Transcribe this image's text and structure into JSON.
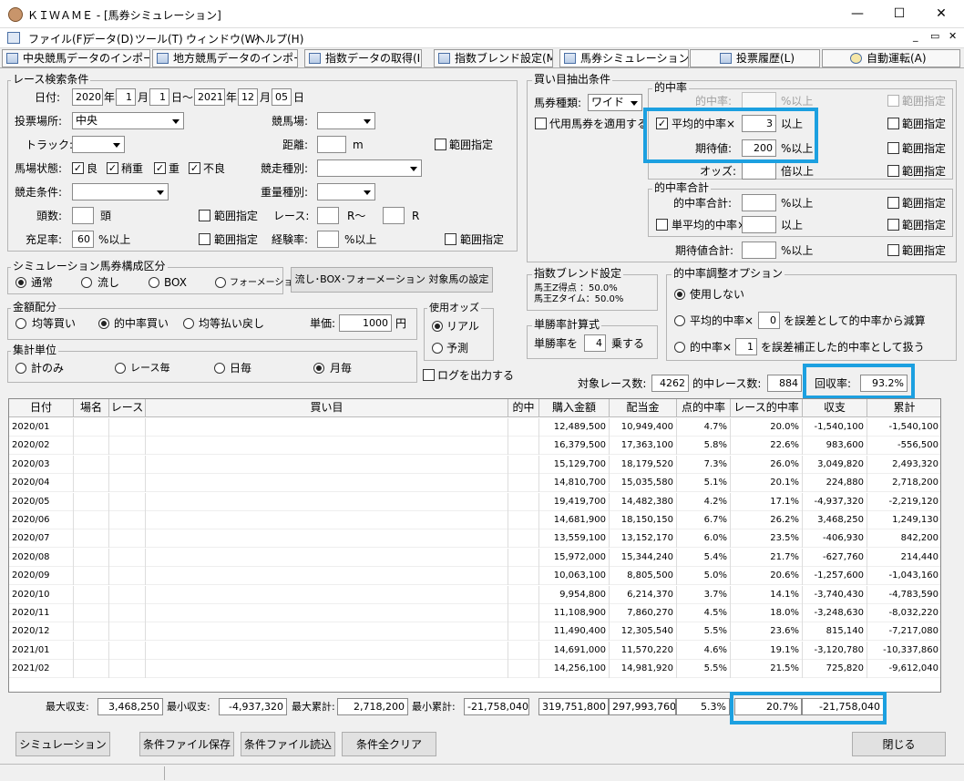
{
  "window": {
    "title": "ＫＩＷＡＭＥ - [馬券シミュレーション]"
  },
  "menu": [
    "ファイル(F)",
    "データ(D)",
    "ツール(T)",
    "ウィンドウ(W)",
    "ヘルプ(H)"
  ],
  "tabs": [
    "中央競馬データのインポート(J)",
    "地方競馬データのインポート(N)",
    "指数データの取得(I)",
    "指数ブレンド設定(M)",
    "馬券シミュレーション(B)",
    "投票履歴(L)",
    "自動運転(A)"
  ],
  "search": {
    "title": "レース検索条件",
    "date_label": "日付:",
    "from_year": "2020",
    "from_month": "1",
    "from_day": "1",
    "to_year": "2021",
    "to_month": "12",
    "to_day": "05",
    "year": "年",
    "month": "月",
    "day": "日",
    "tilde": "日～",
    "place_label": "投票場所:",
    "place": "中央",
    "course_label": "競馬場:",
    "track_label": "トラック:",
    "distance_label": "距離:",
    "m": "m",
    "range": "範囲指定",
    "condition_label": "馬場状態:",
    "cond": [
      "良",
      "稍重",
      "重",
      "不良"
    ],
    "race_type_label": "競走種別:",
    "race_cond_label": "競走条件:",
    "weight_label": "重量種別:",
    "heads_label": "頭数:",
    "heads_unit": "頭",
    "race_label": "レース:",
    "race_from": "R～",
    "race_to": "R",
    "fill_label": "充足率:",
    "fill": "60",
    "pct_over": "%以上",
    "exp_label": "経験率:"
  },
  "sim": {
    "title": "シミュレーション馬券構成区分",
    "opts": [
      "通常",
      "流し",
      "BOX",
      "フォーメーション"
    ],
    "setting_button": "流し･BOX･フォーメーション 対象馬の設定"
  },
  "money": {
    "title": "金額配分",
    "opts": [
      "均等買い",
      "的中率買い",
      "均等払い戻し"
    ],
    "unit_label": "単価:",
    "unit": "1000",
    "yen": "円"
  },
  "odds": {
    "title": "使用オッズ",
    "opts": [
      "リアル",
      "予測"
    ]
  },
  "agg": {
    "title": "集計単位",
    "opts": [
      "計のみ",
      "レース毎",
      "日毎",
      "月毎"
    ],
    "log": "ログを出力する"
  },
  "buy": {
    "title": "買い目抽出条件",
    "type_label": "馬券種類:",
    "type": "ワイド",
    "substitute": "代用馬券を適用する",
    "hit_title": "的中率",
    "hit": "的中率:",
    "avg_hit": "平均的中率×",
    "avg_val": "3",
    "ijo": "以上",
    "expect": "期待値:",
    "expect_val": "200",
    "odds": "オッズ:",
    "bai": "倍以上",
    "sum_title": "的中率合計",
    "sum_hit": "的中率合計:",
    "single": "単平均的中率×",
    "exp_sum": "期待値合計:",
    "range": "範囲指定",
    "pct_over": "%以上"
  },
  "blend": {
    "title": "指数ブレンド設定",
    "l1": "馬王Z得点 ：50.0%",
    "l2": "馬王Zタイム：50.0%"
  },
  "calc": {
    "title": "単勝率計算式",
    "pre": "単勝率を",
    "val": "4",
    "post": "乗する"
  },
  "adjust": {
    "title": "的中率調整オプション",
    "o1": "使用しない",
    "o2a": "平均的中率×",
    "o2v": "0",
    "o2b": "を誤差として的中率から減算",
    "o3a": "的中率×",
    "o3v": "1",
    "o3b": "を誤差補正した的中率として扱う"
  },
  "stats": {
    "target_label": "対象レース数:",
    "target": "4262",
    "hit_label": "的中レース数:",
    "hit": "884",
    "recovery_label": "回収率:",
    "recovery": "93.2%"
  },
  "table": {
    "headers": [
      "日付",
      "場名",
      "レース",
      "買い目",
      "的中",
      "購入金額",
      "配当金",
      "点的中率",
      "レース的中率",
      "収支",
      "累計"
    ],
    "rows": [
      [
        "2020/01",
        "12,489,500",
        "10,949,400",
        "4.7%",
        "20.0%",
        "-1,540,100",
        "-1,540,100"
      ],
      [
        "2020/02",
        "16,379,500",
        "17,363,100",
        "5.8%",
        "22.6%",
        "983,600",
        "-556,500"
      ],
      [
        "2020/03",
        "15,129,700",
        "18,179,520",
        "7.3%",
        "26.0%",
        "3,049,820",
        "2,493,320"
      ],
      [
        "2020/04",
        "14,810,700",
        "15,035,580",
        "5.1%",
        "20.1%",
        "224,880",
        "2,718,200"
      ],
      [
        "2020/05",
        "19,419,700",
        "14,482,380",
        "4.2%",
        "17.1%",
        "-4,937,320",
        "-2,219,120"
      ],
      [
        "2020/06",
        "14,681,900",
        "18,150,150",
        "6.7%",
        "26.2%",
        "3,468,250",
        "1,249,130"
      ],
      [
        "2020/07",
        "13,559,100",
        "13,152,170",
        "6.0%",
        "23.5%",
        "-406,930",
        "842,200"
      ],
      [
        "2020/08",
        "15,972,000",
        "15,344,240",
        "5.4%",
        "21.7%",
        "-627,760",
        "214,440"
      ],
      [
        "2020/09",
        "10,063,100",
        "8,805,500",
        "5.0%",
        "20.6%",
        "-1,257,600",
        "-1,043,160"
      ],
      [
        "2020/10",
        "9,954,800",
        "6,214,370",
        "3.7%",
        "14.1%",
        "-3,740,430",
        "-4,783,590"
      ],
      [
        "2020/11",
        "11,108,900",
        "7,860,270",
        "4.5%",
        "18.0%",
        "-3,248,630",
        "-8,032,220"
      ],
      [
        "2020/12",
        "11,490,400",
        "12,305,540",
        "5.5%",
        "23.6%",
        "815,140",
        "-7,217,080"
      ],
      [
        "2021/01",
        "14,691,000",
        "11,570,220",
        "4.6%",
        "19.1%",
        "-3,120,780",
        "-10,337,860"
      ],
      [
        "2021/02",
        "14,256,100",
        "14,981,920",
        "5.5%",
        "21.5%",
        "725,820",
        "-9,612,040"
      ]
    ]
  },
  "footer": {
    "max_label": "最大収支:",
    "max": "3,468,250",
    "min_label": "最小収支:",
    "min": "-4,937,320",
    "maxc_label": "最大累計:",
    "maxc": "2,718,200",
    "minc_label": "最小累計:",
    "minc": "-21,758,040",
    "buy": "319,751,800",
    "pay": "297,993,760",
    "pt": "5.3%",
    "race": "20.7%",
    "total": "-21,758,040"
  },
  "buttons": {
    "sim": "シミュレーション",
    "save": "条件ファイル保存",
    "load": "条件ファイル読込",
    "clear": "条件全クリア",
    "close": "閉じる"
  }
}
